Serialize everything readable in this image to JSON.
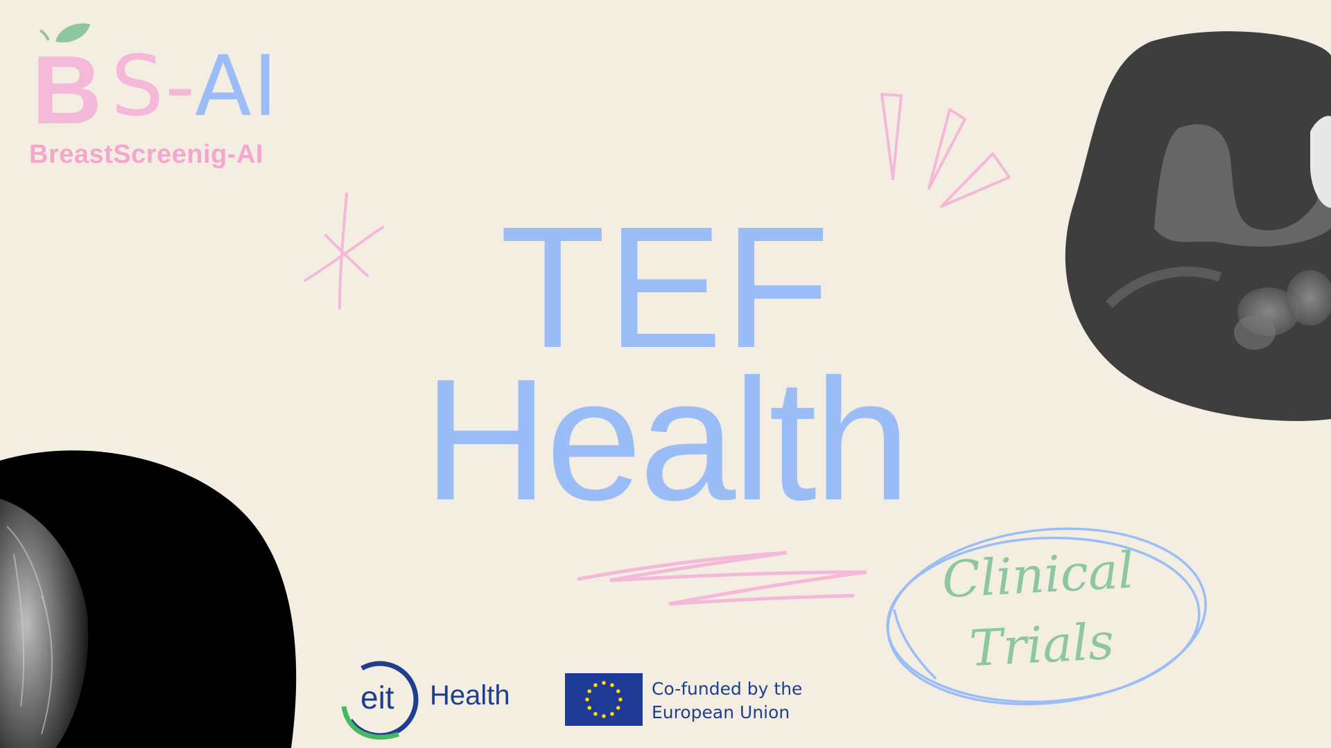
{
  "logo": {
    "b_letter": "B",
    "mark_s": "S",
    "mark_dash": "-",
    "mark_ai": "AI",
    "subtitle": "BreastScreenig-AI",
    "colors": {
      "pink": "#F4B8D8",
      "blue": "#9ABDF8",
      "leaf": "#8CC7A0"
    }
  },
  "title": {
    "line1": "TEF",
    "line2": "Health",
    "color": "#9ABDF8"
  },
  "badge": {
    "line1": "Clinical",
    "line2": "Trials",
    "color": "#8CC7A0",
    "ring_color": "#9ABDF8"
  },
  "partners": {
    "eit": {
      "mark": "eit",
      "name": "Health"
    },
    "eu": {
      "line1": "Co-funded by the",
      "line2": "European Union",
      "flag_color": "#1F3A94",
      "star_color": "#FFDD00"
    }
  },
  "images": [
    {
      "icon": "mri-scan-image"
    },
    {
      "icon": "mammogram-image"
    }
  ],
  "accent_colors": {
    "background": "#F3EEE1",
    "pink": "#F4B8D8",
    "dark_blob": "#3E3E3E"
  }
}
